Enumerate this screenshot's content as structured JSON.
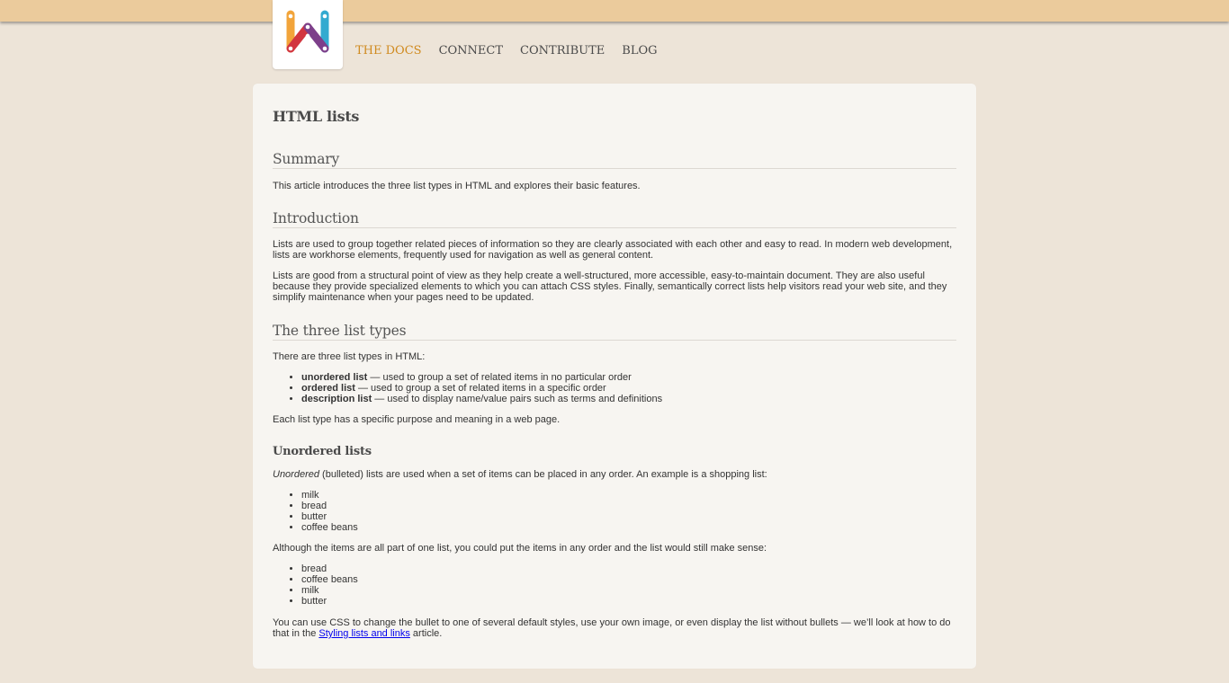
{
  "nav": {
    "items": [
      {
        "label": "THE DOCS",
        "active": true
      },
      {
        "label": "CONNECT",
        "active": false
      },
      {
        "label": "CONTRIBUTE",
        "active": false
      },
      {
        "label": "BLOG",
        "active": false
      }
    ]
  },
  "colors": {
    "topbar": "#ebcb9c",
    "page_bg": "#ede4d8",
    "card_bg": "#f7f5f1",
    "nav_active": "#d08a1f",
    "link": "#0000ee"
  },
  "logo": {
    "icon": "webplatform-logo"
  },
  "article": {
    "title": "HTML lists",
    "summary_heading": "Summary",
    "summary_text": "This article introduces the three list types in HTML and explores their basic features.",
    "intro_heading": "Introduction",
    "intro_p1": "Lists are used to group together related pieces of information so they are clearly associated with each other and easy to read. In modern web development, lists are workhorse elements, frequently used for navigation as well as general content.",
    "intro_p2": "Lists are good from a structural point of view as they help create a well-structured, more accessible, easy-to-maintain document. They are also useful because they provide specialized elements to which you can attach CSS styles. Finally, semantically correct lists help visitors read your web site, and they simplify maintenance when your pages need to be updated.",
    "types_heading": "The three list types",
    "types_intro": "There are three list types in HTML:",
    "types": [
      {
        "term": "unordered list",
        "desc": " — used to group a set of related items in no particular order"
      },
      {
        "term": "ordered list",
        "desc": " — used to group a set of related items in a specific order"
      },
      {
        "term": "description list",
        "desc": " — used to display name/value pairs such as terms and definitions"
      }
    ],
    "types_outro": "Each list type has a specific purpose and meaning in a web page.",
    "unordered_heading": "Unordered lists",
    "unordered_em": "Unordered",
    "unordered_intro_rest": " (bulleted) lists are used when a set of items can be placed in any order. An example is a shopping list:",
    "shopping_list_1": [
      "milk",
      "bread",
      "butter",
      "coffee beans"
    ],
    "although_text": "Although the items are all part of one list, you could put the items in any order and the list would still make sense:",
    "shopping_list_2": [
      "bread",
      "coffee beans",
      "milk",
      "butter"
    ],
    "css_text_before": "You can use CSS to change the bullet to one of several default styles, use your own image, or even display the list without bullets — we’ll look at how to do that in the ",
    "css_link": "Styling lists and links",
    "css_text_after": " article."
  }
}
